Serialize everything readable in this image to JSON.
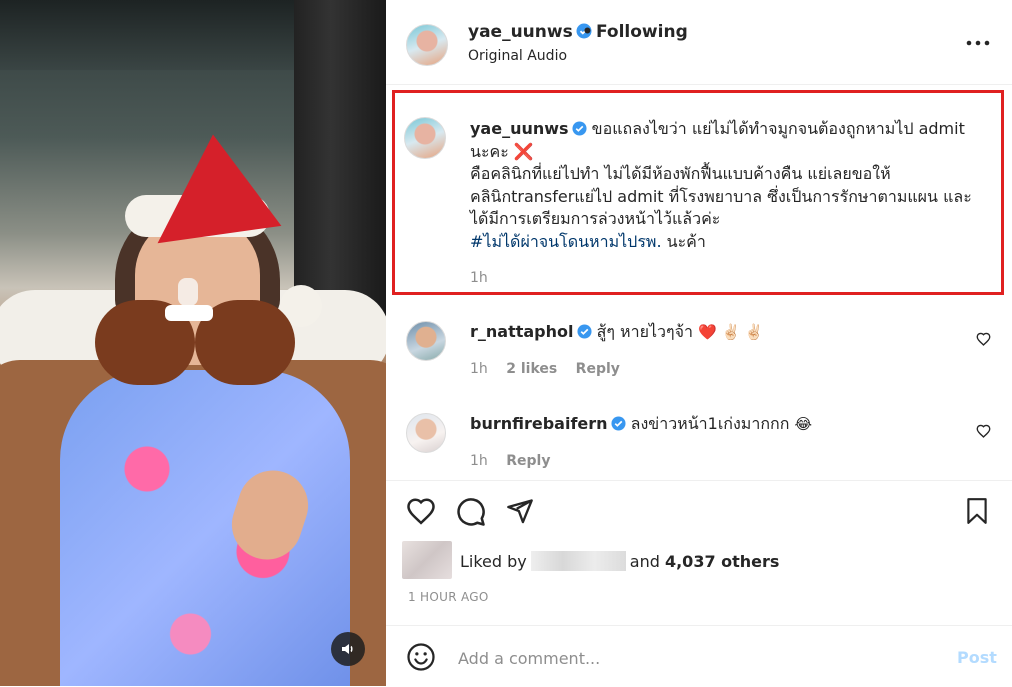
{
  "post": {
    "username": "yae_uunws",
    "follow_label": "Following",
    "separator": "•",
    "audio_label": "Original Audio"
  },
  "caption": {
    "username": "yae_uunws",
    "line1": "ขอแถลงไขว่า แย่ไม่ได้ทำจมูกจนต้องถูกหามไป admit",
    "line2": "นะคะ",
    "line2_emoji": "❌",
    "line3": "คือคลินิกที่แย่ไปทำ ไม่ได้มีห้องพักฟื้นแบบค้างคืน แย่เลยขอให้",
    "line4": "คลินิกtransferแย่ไป admit ที่โรงพยาบาล ซึ่งเป็นการรักษาตามแผน และ",
    "line5": "ได้มีการเตรียมการล่วงหน้าไว้แล้วค่ะ",
    "hashtag": "#ไม่ได้ผ่าจนโดนหามไปรพ.",
    "hashtag_suffix": "นะค้า",
    "time": "1h"
  },
  "comments": [
    {
      "username": "r_nattaphol",
      "text": "สู้ๆ หายไวๆจ้า",
      "emojis": "❤️ ✌🏻 ✌🏻",
      "time": "1h",
      "likes": "2 likes",
      "reply": "Reply"
    },
    {
      "username": "burnfirebaifern",
      "text": "ลงข่าวหน้า1เก่งมากกก",
      "emojis": "😂",
      "time": "1h",
      "reply": "Reply"
    }
  ],
  "likes": {
    "prefix": "Liked by",
    "and": "and",
    "others": "4,037 others"
  },
  "posted_time": "1 HOUR AGO",
  "comment_input": {
    "placeholder": "Add a comment...",
    "post_label": "Post"
  },
  "icons": {
    "verified": "verified-badge-icon",
    "more": "more-horizontal-icon",
    "like": "heart-icon",
    "comment": "comment-bubble-icon",
    "share": "paper-plane-icon",
    "save": "bookmark-icon",
    "emoji": "smiley-icon",
    "sound": "speaker-icon"
  },
  "colors": {
    "verified_blue": "#3897f0",
    "highlight_border": "#e02020",
    "hashtag": "#00376b",
    "post_disabled": "#b3dbff",
    "heart_red": "#ed4956"
  }
}
